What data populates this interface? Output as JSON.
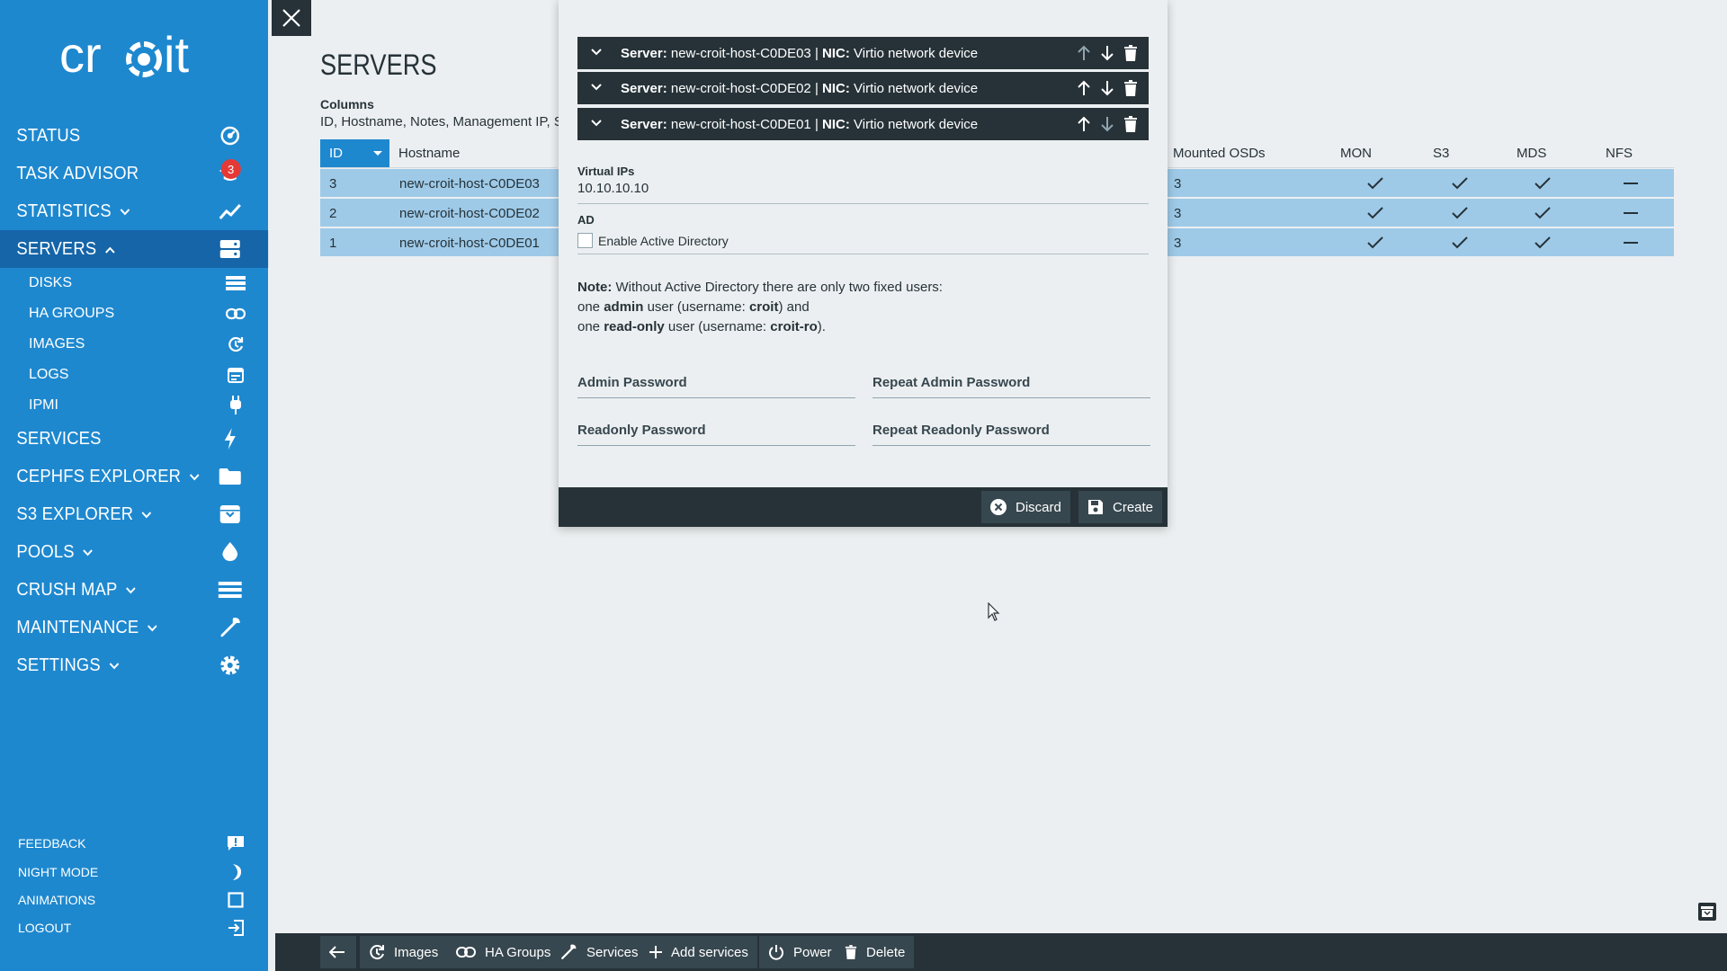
{
  "sidebar": {
    "logo_text": "croit",
    "nav": {
      "status": "STATUS",
      "task_advisor": "TASK ADVISOR",
      "task_advisor_badge": "3",
      "statistics": "STATISTICS",
      "servers": "SERVERS",
      "services": "SERVICES",
      "cephfs_explorer": "CEPHFS EXPLORER",
      "s3_explorer": "S3 EXPLORER",
      "pools": "POOLS",
      "crush_map": "CRUSH MAP",
      "maintenance": "MAINTENANCE",
      "settings": "SETTINGS"
    },
    "sub": {
      "disks": "DISKS",
      "ha_groups": "HA GROUPS",
      "images": "IMAGES",
      "logs": "LOGS",
      "ipmi": "IPMI"
    },
    "footer": {
      "feedback": "FEEDBACK",
      "night_mode": "NIGHT MODE",
      "animations": "ANIMATIONS",
      "logout": "LOGOUT"
    }
  },
  "main": {
    "title": "SERVERS",
    "columns_label": "Columns",
    "columns_value": "ID, Hostname, Notes, Management IP, S",
    "table": {
      "headers": {
        "id": "ID",
        "hostname": "Hostname",
        "mounted_osds": "Mounted OSDs",
        "mon": "MON",
        "s3": "S3",
        "mds": "MDS",
        "nfs": "NFS"
      },
      "rows": [
        {
          "id": "3",
          "hostname": "new-croit-host-C0DE03",
          "mounted_osds": "3"
        },
        {
          "id": "2",
          "hostname": "new-croit-host-C0DE02",
          "mounted_osds": "3"
        },
        {
          "id": "1",
          "hostname": "new-croit-host-C0DE01",
          "mounted_osds": "3"
        }
      ]
    }
  },
  "modal": {
    "nics": [
      {
        "server_label": "Server:",
        "server": "new-croit-host-C0DE03",
        "sep": "|",
        "nic_label": "NIC:",
        "nic": "Virtio network device"
      },
      {
        "server_label": "Server:",
        "server": "new-croit-host-C0DE02",
        "sep": "|",
        "nic_label": "NIC:",
        "nic": "Virtio network device"
      },
      {
        "server_label": "Server:",
        "server": "new-croit-host-C0DE01",
        "sep": "|",
        "nic_label": "NIC:",
        "nic": "Virtio network device"
      }
    ],
    "virtual_ips_label": "Virtual IPs",
    "virtual_ips_value": "10.10.10.10",
    "ad_label": "AD",
    "ad_checkbox_label": "Enable Active Directory",
    "note": {
      "note_label": "Note:",
      "line1": "Without Active Directory there are only two fixed users:",
      "line2_a": "one",
      "line2_role": "admin",
      "line2_b": "user (username:",
      "line2_user": "croit",
      "line2_c": ") and",
      "line3_a": "one",
      "line3_role": "read-only",
      "line3_b": "user (username:",
      "line3_user": "croit-ro",
      "line3_c": ")."
    },
    "admin_password": "Admin Password",
    "repeat_admin_password": "Repeat Admin Password",
    "readonly_password": "Readonly Password",
    "repeat_readonly_password": "Repeat Readonly Password",
    "discard": "Discard",
    "create": "Create"
  },
  "toolbar": {
    "images": "Images",
    "ha_groups": "HA Groups",
    "services": "Services",
    "add_services": "Add services",
    "power": "Power",
    "delete": "Delete"
  },
  "colors": {
    "sidebar": "#1e88cf",
    "sidebar_active": "#1565a8",
    "dark": "#263238",
    "row_selected": "#9ecae8",
    "badge": "#e53935"
  }
}
